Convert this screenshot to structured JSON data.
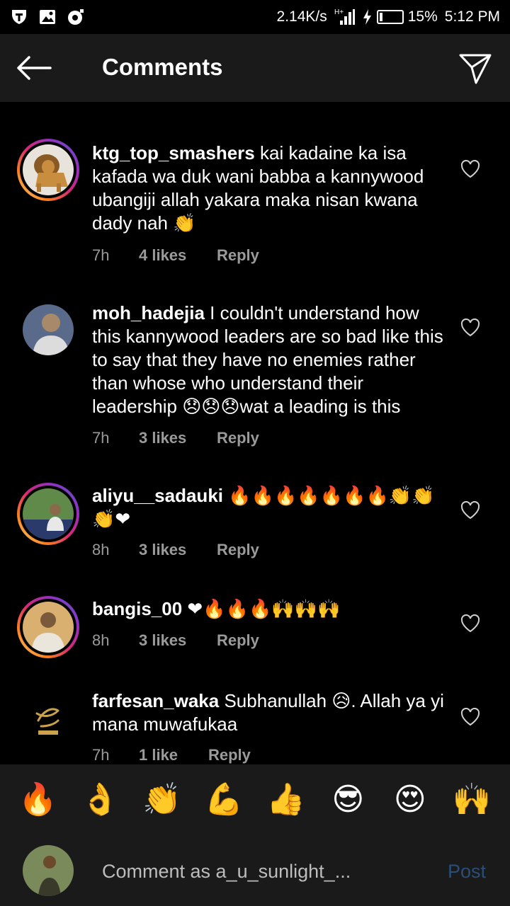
{
  "status_bar": {
    "speed": "2.14K/s",
    "network": "H+",
    "battery": "15%",
    "battery_level": 0.15,
    "time": "5:12 PM"
  },
  "header": {
    "title": "Comments",
    "back_icon": "arrow-left-icon",
    "share_icon": "paper-plane-icon"
  },
  "comments": [
    {
      "user": "ktg_top_smashers",
      "text": "kai kadaine ka isa kafada wa duk wani babba a kannywood ubangiji allah yakara maka nisan kwana dady nah 👏",
      "time": "7h",
      "likes": "4 likes",
      "reply": "Reply"
    },
    {
      "user": "moh_hadejia",
      "text": "I couldn't understand how this kannywood leaders are so bad like this to say that they have no enemies rather than whose who understand their leadership 😞😞😞wat a leading is this",
      "time": "7h",
      "likes": "3 likes",
      "reply": "Reply"
    },
    {
      "user": "aliyu__sadauki",
      "text": "🔥🔥🔥🔥🔥🔥🔥👏👏👏❤",
      "time": "8h",
      "likes": "3 likes",
      "reply": "Reply"
    },
    {
      "user": "bangis_00",
      "text": "❤🔥🔥🔥🙌🙌🙌",
      "time": "8h",
      "likes": "3 likes",
      "reply": "Reply"
    },
    {
      "user": "farfesan_waka",
      "text": "Subhanullah 😥. Allah ya yi mana muwafukaa",
      "time": "7h",
      "likes": "1 like",
      "reply": "Reply"
    }
  ],
  "emoji_bar": [
    "🔥",
    "👌",
    "👏",
    "💪",
    "👍",
    "😎",
    "😍",
    "🙌"
  ],
  "input": {
    "placeholder": "Comment as a_u_sunlight_...",
    "post_label": "Post"
  },
  "colors": {
    "background": "#000000",
    "bar": "#1a1a1a",
    "muted_text": "#9a9a9a",
    "post_disabled": "#2a4d7a"
  }
}
